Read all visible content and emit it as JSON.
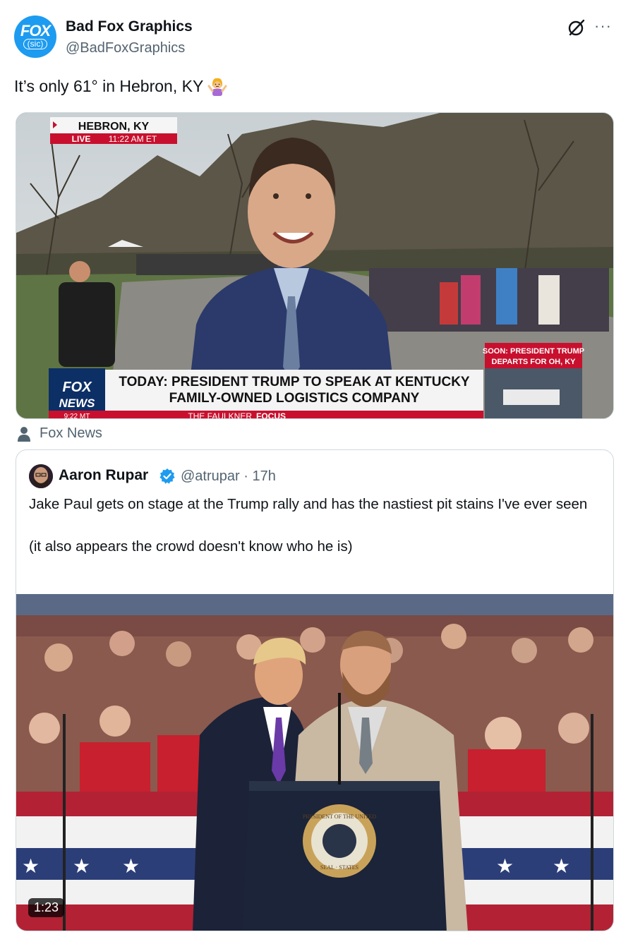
{
  "author": {
    "avatar_text": "FOX",
    "avatar_subtext": "(sic)",
    "name": "Bad Fox Graphics",
    "handle": "@BadFoxGraphics"
  },
  "tweet": {
    "text": "It’s only 61° in Hebron, KY"
  },
  "media": {
    "location_banner": "HEBRON, KY",
    "live_label": "LIVE",
    "time_label": "11:22 AM ET",
    "network_logo_line1": "FOX",
    "network_logo_line2": "NEWS",
    "network_logo_time": "9:22 MT",
    "headline_line1": "TODAY: PRESIDENT TRUMP TO SPEAK AT KENTUCKY",
    "headline_line2": "FAMILY-OWNED LOGISTICS COMPANY",
    "show_name_1": "THE FAULKNER",
    "show_name_2": "FOCUS",
    "soon_line1": "SOON: PRESIDENT TRUMP",
    "soon_line2": "DEPARTS FOR OH, KY"
  },
  "source_label": "Fox News",
  "quoted": {
    "name": "Aaron Rupar",
    "handle": "@atrupar",
    "separator": "·",
    "time": "17h",
    "text": "Jake Paul gets on stage at the Trump rally and has the nastiest pit stains I've ever seen\n\n(it also appears the crowd doesn't know who he is)",
    "video_duration": "1:23",
    "podium_seal_top": "PRESIDENT OF THE UNITED",
    "podium_seal_bottom": "SEAL · STATES"
  },
  "colors": {
    "brand_blue": "#1d9bf0",
    "secondary_text": "#536471",
    "fox_red": "#c8102e",
    "verified_blue": "#1d9bf0"
  },
  "icons": [
    "grok-icon",
    "more-icon",
    "person-icon",
    "verified-icon",
    "woman-shrugging-emoji"
  ]
}
